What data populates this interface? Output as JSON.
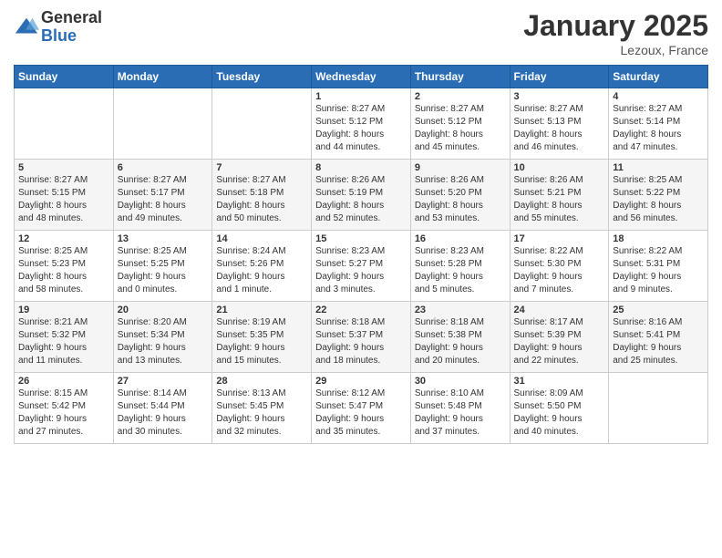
{
  "header": {
    "logo_general": "General",
    "logo_blue": "Blue",
    "month_title": "January 2025",
    "location": "Lezoux, France"
  },
  "days_of_week": [
    "Sunday",
    "Monday",
    "Tuesday",
    "Wednesday",
    "Thursday",
    "Friday",
    "Saturday"
  ],
  "weeks": [
    [
      {
        "day": "",
        "info": ""
      },
      {
        "day": "",
        "info": ""
      },
      {
        "day": "",
        "info": ""
      },
      {
        "day": "1",
        "info": "Sunrise: 8:27 AM\nSunset: 5:12 PM\nDaylight: 8 hours\nand 44 minutes."
      },
      {
        "day": "2",
        "info": "Sunrise: 8:27 AM\nSunset: 5:12 PM\nDaylight: 8 hours\nand 45 minutes."
      },
      {
        "day": "3",
        "info": "Sunrise: 8:27 AM\nSunset: 5:13 PM\nDaylight: 8 hours\nand 46 minutes."
      },
      {
        "day": "4",
        "info": "Sunrise: 8:27 AM\nSunset: 5:14 PM\nDaylight: 8 hours\nand 47 minutes."
      }
    ],
    [
      {
        "day": "5",
        "info": "Sunrise: 8:27 AM\nSunset: 5:15 PM\nDaylight: 8 hours\nand 48 minutes."
      },
      {
        "day": "6",
        "info": "Sunrise: 8:27 AM\nSunset: 5:17 PM\nDaylight: 8 hours\nand 49 minutes."
      },
      {
        "day": "7",
        "info": "Sunrise: 8:27 AM\nSunset: 5:18 PM\nDaylight: 8 hours\nand 50 minutes."
      },
      {
        "day": "8",
        "info": "Sunrise: 8:26 AM\nSunset: 5:19 PM\nDaylight: 8 hours\nand 52 minutes."
      },
      {
        "day": "9",
        "info": "Sunrise: 8:26 AM\nSunset: 5:20 PM\nDaylight: 8 hours\nand 53 minutes."
      },
      {
        "day": "10",
        "info": "Sunrise: 8:26 AM\nSunset: 5:21 PM\nDaylight: 8 hours\nand 55 minutes."
      },
      {
        "day": "11",
        "info": "Sunrise: 8:25 AM\nSunset: 5:22 PM\nDaylight: 8 hours\nand 56 minutes."
      }
    ],
    [
      {
        "day": "12",
        "info": "Sunrise: 8:25 AM\nSunset: 5:23 PM\nDaylight: 8 hours\nand 58 minutes."
      },
      {
        "day": "13",
        "info": "Sunrise: 8:25 AM\nSunset: 5:25 PM\nDaylight: 9 hours\nand 0 minutes."
      },
      {
        "day": "14",
        "info": "Sunrise: 8:24 AM\nSunset: 5:26 PM\nDaylight: 9 hours\nand 1 minute."
      },
      {
        "day": "15",
        "info": "Sunrise: 8:23 AM\nSunset: 5:27 PM\nDaylight: 9 hours\nand 3 minutes."
      },
      {
        "day": "16",
        "info": "Sunrise: 8:23 AM\nSunset: 5:28 PM\nDaylight: 9 hours\nand 5 minutes."
      },
      {
        "day": "17",
        "info": "Sunrise: 8:22 AM\nSunset: 5:30 PM\nDaylight: 9 hours\nand 7 minutes."
      },
      {
        "day": "18",
        "info": "Sunrise: 8:22 AM\nSunset: 5:31 PM\nDaylight: 9 hours\nand 9 minutes."
      }
    ],
    [
      {
        "day": "19",
        "info": "Sunrise: 8:21 AM\nSunset: 5:32 PM\nDaylight: 9 hours\nand 11 minutes."
      },
      {
        "day": "20",
        "info": "Sunrise: 8:20 AM\nSunset: 5:34 PM\nDaylight: 9 hours\nand 13 minutes."
      },
      {
        "day": "21",
        "info": "Sunrise: 8:19 AM\nSunset: 5:35 PM\nDaylight: 9 hours\nand 15 minutes."
      },
      {
        "day": "22",
        "info": "Sunrise: 8:18 AM\nSunset: 5:37 PM\nDaylight: 9 hours\nand 18 minutes."
      },
      {
        "day": "23",
        "info": "Sunrise: 8:18 AM\nSunset: 5:38 PM\nDaylight: 9 hours\nand 20 minutes."
      },
      {
        "day": "24",
        "info": "Sunrise: 8:17 AM\nSunset: 5:39 PM\nDaylight: 9 hours\nand 22 minutes."
      },
      {
        "day": "25",
        "info": "Sunrise: 8:16 AM\nSunset: 5:41 PM\nDaylight: 9 hours\nand 25 minutes."
      }
    ],
    [
      {
        "day": "26",
        "info": "Sunrise: 8:15 AM\nSunset: 5:42 PM\nDaylight: 9 hours\nand 27 minutes."
      },
      {
        "day": "27",
        "info": "Sunrise: 8:14 AM\nSunset: 5:44 PM\nDaylight: 9 hours\nand 30 minutes."
      },
      {
        "day": "28",
        "info": "Sunrise: 8:13 AM\nSunset: 5:45 PM\nDaylight: 9 hours\nand 32 minutes."
      },
      {
        "day": "29",
        "info": "Sunrise: 8:12 AM\nSunset: 5:47 PM\nDaylight: 9 hours\nand 35 minutes."
      },
      {
        "day": "30",
        "info": "Sunrise: 8:10 AM\nSunset: 5:48 PM\nDaylight: 9 hours\nand 37 minutes."
      },
      {
        "day": "31",
        "info": "Sunrise: 8:09 AM\nSunset: 5:50 PM\nDaylight: 9 hours\nand 40 minutes."
      },
      {
        "day": "",
        "info": ""
      }
    ]
  ]
}
